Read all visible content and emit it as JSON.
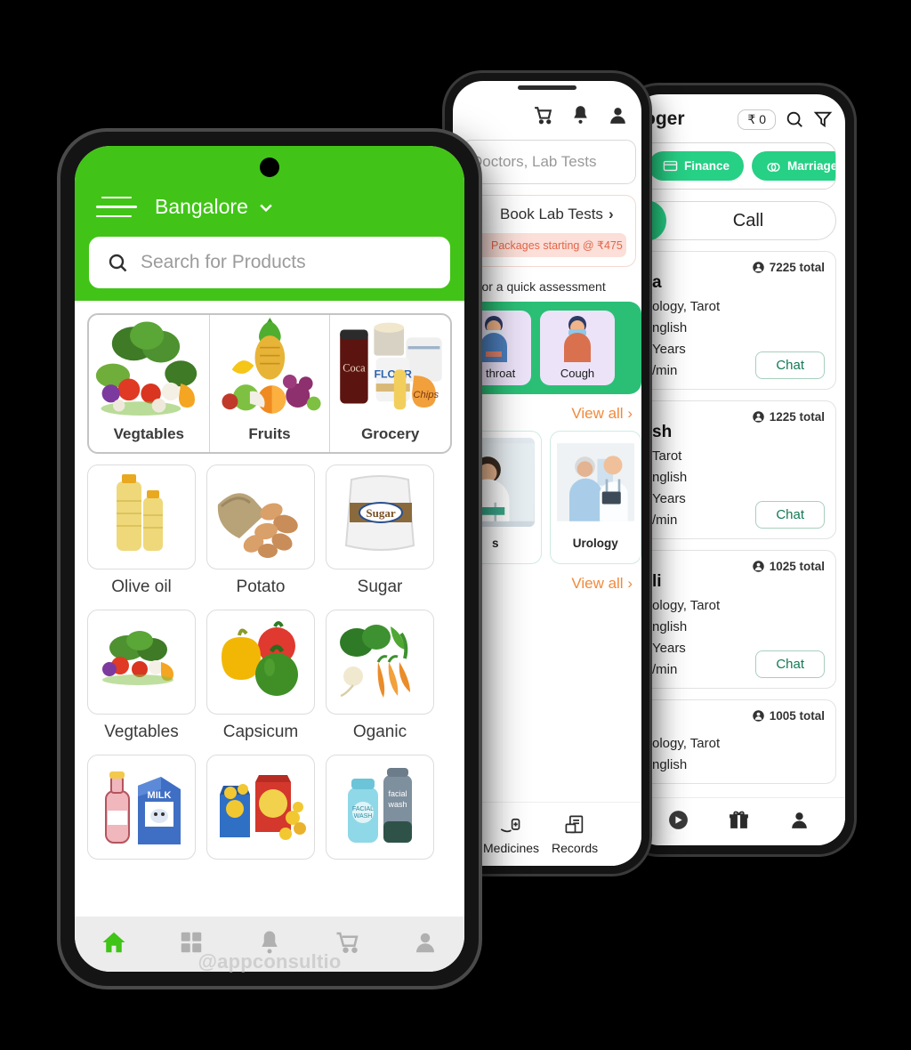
{
  "watermark": "@appconsultio",
  "grocery": {
    "header": {
      "city": "Bangalore",
      "menu_icon": "hamburger-menu-icon",
      "chevron_icon": "chevron-down-icon",
      "search_placeholder": "Search for Products",
      "search_icon": "search-icon",
      "accent_color": "#41c417"
    },
    "categories": [
      {
        "label": "Vegtables"
      },
      {
        "label": "Fruits"
      },
      {
        "label": "Grocery"
      }
    ],
    "products": [
      {
        "label": "Olive oil"
      },
      {
        "label": "Potato"
      },
      {
        "label": "Sugar"
      },
      {
        "label": "Vegtables"
      },
      {
        "label": "Capsicum"
      },
      {
        "label": "Oganic"
      },
      {
        "label": ""
      },
      {
        "label": ""
      },
      {
        "label": ""
      }
    ],
    "nav": [
      {
        "name": "home-icon",
        "active": true
      },
      {
        "name": "grid-icon",
        "active": false
      },
      {
        "name": "bell-icon",
        "active": false
      },
      {
        "name": "cart-icon",
        "active": false
      },
      {
        "name": "person-icon",
        "active": false
      }
    ]
  },
  "health": {
    "top_icons": [
      "cart-icon",
      "bell-icon",
      "person-icon"
    ],
    "search_placeholder": "Doctors, Lab Tests",
    "lab_card": {
      "title": "Book Lab Tests",
      "chevron": "›",
      "offer": "Packages starting @ ₹475"
    },
    "symptoms_subtitle": "ms for a quick assessment",
    "symptoms": [
      {
        "label": "re throat"
      },
      {
        "label": "Cough"
      }
    ],
    "symptoms_view_all": "View all",
    "specialties": [
      {
        "label": "s"
      },
      {
        "label": "Urology"
      }
    ],
    "specialties_view_all": "View all",
    "view_all_chevron": "›",
    "nav": [
      {
        "label": "Medicines",
        "icon": "medicines-icon"
      },
      {
        "label": "Records",
        "icon": "records-icon"
      }
    ]
  },
  "astrology": {
    "title": "oger",
    "wallet": "₹ 0",
    "search_icon": "search-icon",
    "filter_icon": "filter-icon",
    "chips": [
      {
        "label": "Finance",
        "icon": "card-icon"
      },
      {
        "label": "Marriage",
        "icon": "rings-icon"
      }
    ],
    "call_tab": "Call",
    "cards": [
      {
        "name": "a",
        "skills": "ology, Tarot",
        "languages": "nglish",
        "experience": "Years",
        "rate": "/min",
        "total": "7225 total",
        "action": "Chat"
      },
      {
        "name": "sh",
        "skills": "Tarot",
        "languages": "nglish",
        "experience": "Years",
        "rate": "/min",
        "total": "1225 total",
        "action": "Chat"
      },
      {
        "name": "li",
        "skills": "ology, Tarot",
        "languages": "nglish",
        "experience": "Years",
        "rate": "/min",
        "total": "1025 total",
        "action": "Chat"
      },
      {
        "name": "",
        "skills": "ology, Tarot",
        "languages": "nglish",
        "experience": "",
        "rate": "",
        "total": "1005 total",
        "action": ""
      }
    ],
    "nav": [
      {
        "name": "video-icon"
      },
      {
        "name": "gift-icon"
      },
      {
        "name": "person-icon"
      }
    ]
  }
}
